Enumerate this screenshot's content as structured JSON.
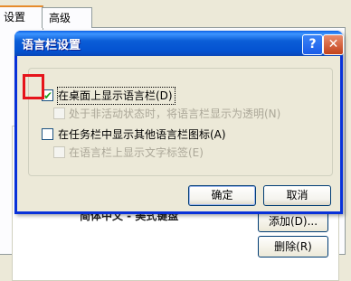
{
  "parent": {
    "tabs": [
      {
        "label": "设置"
      },
      {
        "label": "高级"
      }
    ],
    "partial_text": "简体中文 - 美式键盘",
    "add_button": "添加(D)...",
    "delete_button": "删除(R)"
  },
  "dialog": {
    "title": "语言栏设置",
    "help_glyph": "?",
    "close_glyph": "✕",
    "options": [
      {
        "label": "在桌面上显示语言栏(D)",
        "checked": true,
        "enabled": true
      },
      {
        "label": "处于非活动状态时，将语言栏显示为透明(N)",
        "checked": false,
        "enabled": false
      },
      {
        "label": "在任务栏中显示其他语言栏图标(A)",
        "checked": false,
        "enabled": true
      },
      {
        "label": "在语言栏上显示文字标签(E)",
        "checked": false,
        "enabled": false
      }
    ],
    "ok_button": "确定",
    "cancel_button": "取消"
  },
  "annotation_color": "#e6141b"
}
